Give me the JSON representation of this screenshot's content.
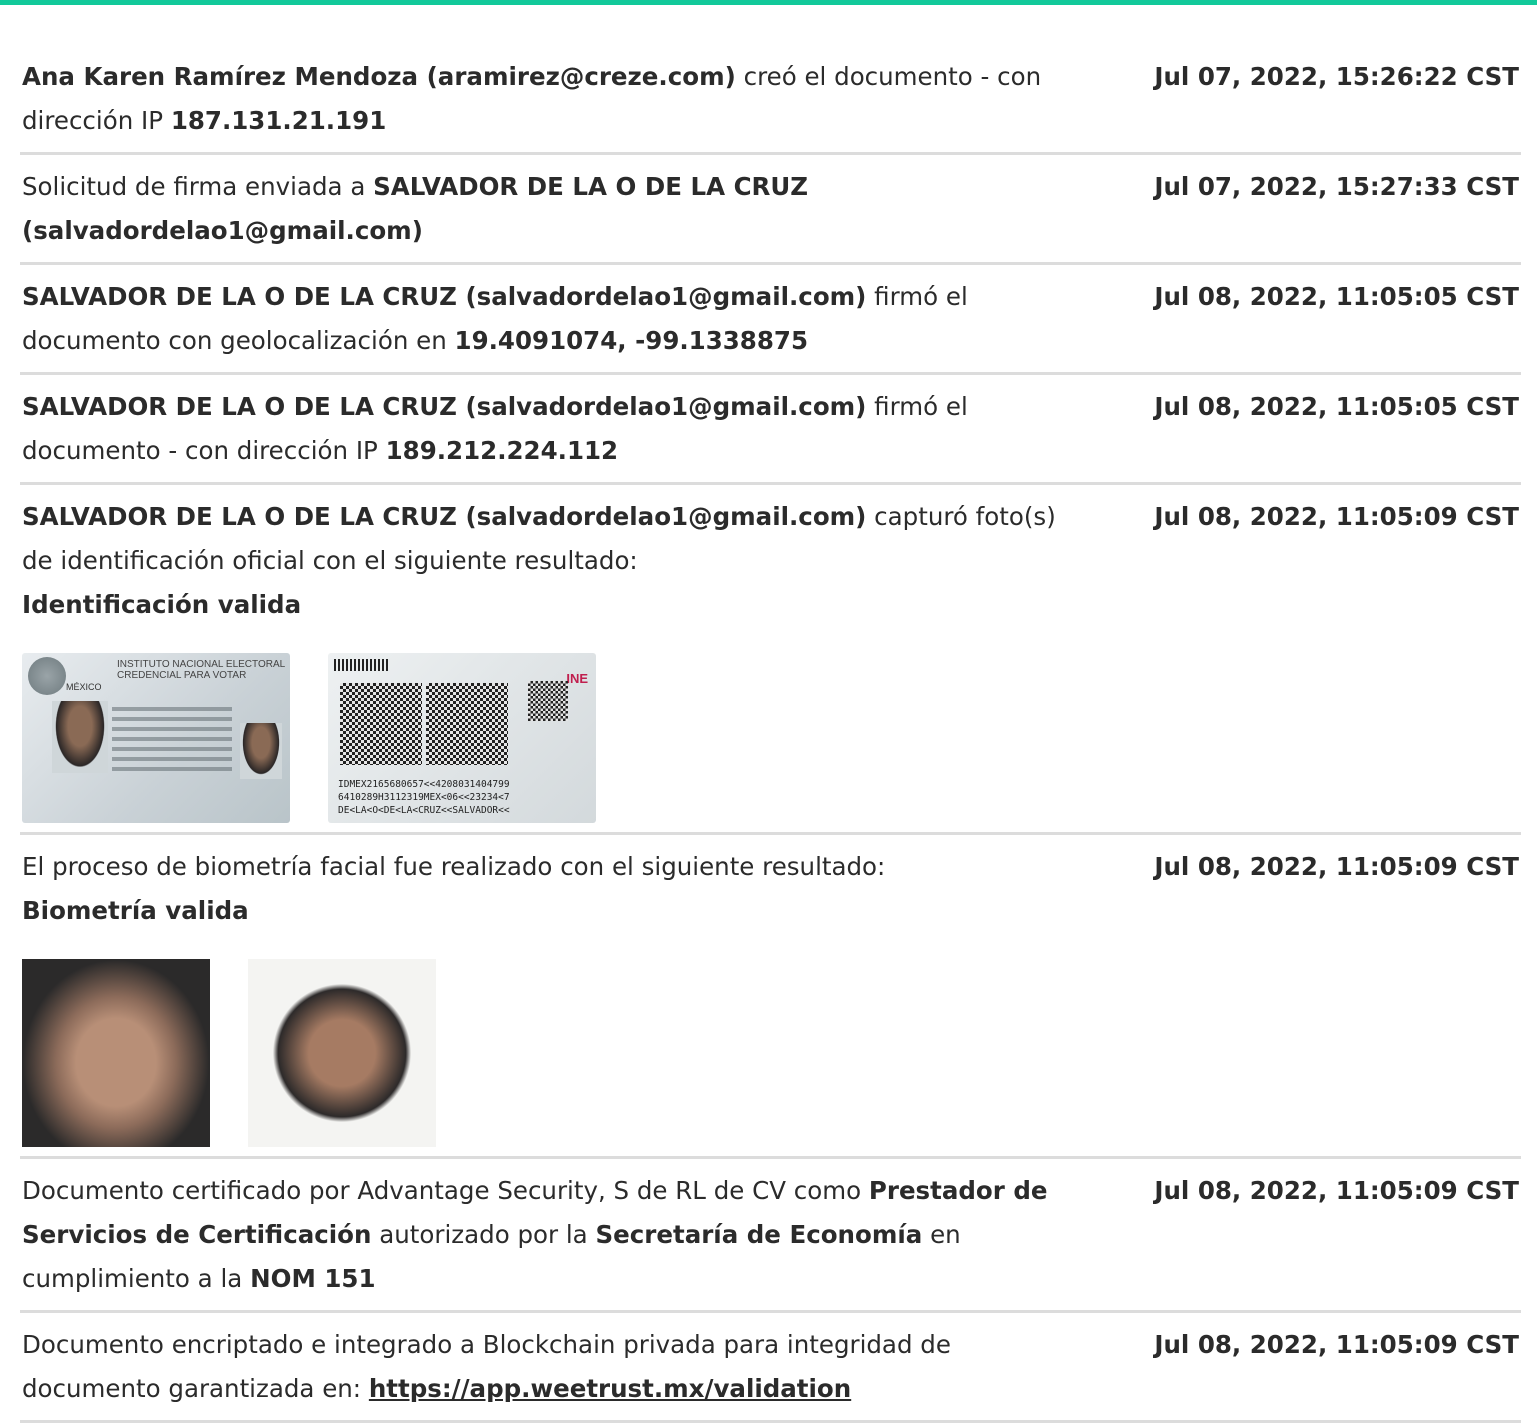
{
  "entries": [
    {
      "parts": [
        {
          "t": "Ana Karen Ramírez Mendoza (aramirez@creze.com)",
          "b": true
        },
        {
          "t": " creó el documento - con dirección IP "
        },
        {
          "t": "187.131.21.191",
          "b": true
        }
      ],
      "timestamp": "Jul 07, 2022, 15:26:22 CST"
    },
    {
      "parts": [
        {
          "t": "Solicitud de firma enviada a "
        },
        {
          "t": "SALVADOR DE LA O DE LA CRUZ (salvadordelao1@gmail.com)",
          "b": true
        }
      ],
      "timestamp": "Jul 07, 2022, 15:27:33 CST"
    },
    {
      "parts": [
        {
          "t": "SALVADOR DE LA O DE LA CRUZ (salvadordelao1@gmail.com)",
          "b": true
        },
        {
          "t": " firmó el documento con geolocalización en "
        },
        {
          "t": "19.4091074, -99.1338875",
          "b": true
        }
      ],
      "timestamp": "Jul 08, 2022, 11:05:05 CST"
    },
    {
      "parts": [
        {
          "t": "SALVADOR DE LA O DE LA CRUZ (salvadordelao1@gmail.com)",
          "b": true
        },
        {
          "t": " firmó el documento - con dirección IP "
        },
        {
          "t": "189.212.224.112",
          "b": true
        }
      ],
      "timestamp": "Jul 08, 2022, 11:05:05 CST"
    },
    {
      "parts": [
        {
          "t": "SALVADOR DE LA O DE LA CRUZ (salvadordelao1@gmail.com)",
          "b": true
        },
        {
          "t": " capturó foto(s) de identificación oficial con el siguiente resultado:"
        },
        {
          "br": true
        },
        {
          "t": "Identificación valida",
          "b": true
        }
      ],
      "timestamp": "Jul 08, 2022, 11:05:09 CST",
      "images": "id"
    },
    {
      "parts": [
        {
          "t": "El proceso de biometría facial fue realizado con el siguiente resultado:"
        },
        {
          "br": true
        },
        {
          "t": "Biometría valida",
          "b": true
        }
      ],
      "timestamp": "Jul 08, 2022, 11:05:09 CST",
      "images": "faces"
    },
    {
      "parts": [
        {
          "t": "Documento certificado por Advantage Security, S de RL de CV como "
        },
        {
          "t": "Prestador de Servicios de Certificación",
          "b": true
        },
        {
          "t": " autorizado por la "
        },
        {
          "t": "Secretaría de Economía",
          "b": true
        },
        {
          "t": " en cumplimiento a la "
        },
        {
          "t": "NOM 151",
          "b": true
        }
      ],
      "timestamp": "Jul 08, 2022, 11:05:09 CST"
    },
    {
      "parts": [
        {
          "t": "Documento encriptado e integrado a Blockchain privada para integridad de documento garantizada en: "
        },
        {
          "t": "https://app.weetrust.mx/validation",
          "link": true
        }
      ],
      "timestamp": "Jul 08, 2022, 11:05:09 CST"
    }
  ],
  "id_card": {
    "front_country": "MÉXICO",
    "front_title_1": "INSTITUTO NACIONAL ELECTORAL",
    "front_title_2": "CREDENCIAL PARA VOTAR",
    "back_logo": "INE",
    "mrz": [
      "IDMEX2165680657<<4208031404799",
      "6410289H3112319MEX<06<<23234<7",
      "DE<LA<O<DE<LA<CRUZ<<SALVADOR<<"
    ]
  },
  "colors": {
    "accent": "#12c99a",
    "divider": "#dcdcdc",
    "text": "#2b2b2b"
  }
}
